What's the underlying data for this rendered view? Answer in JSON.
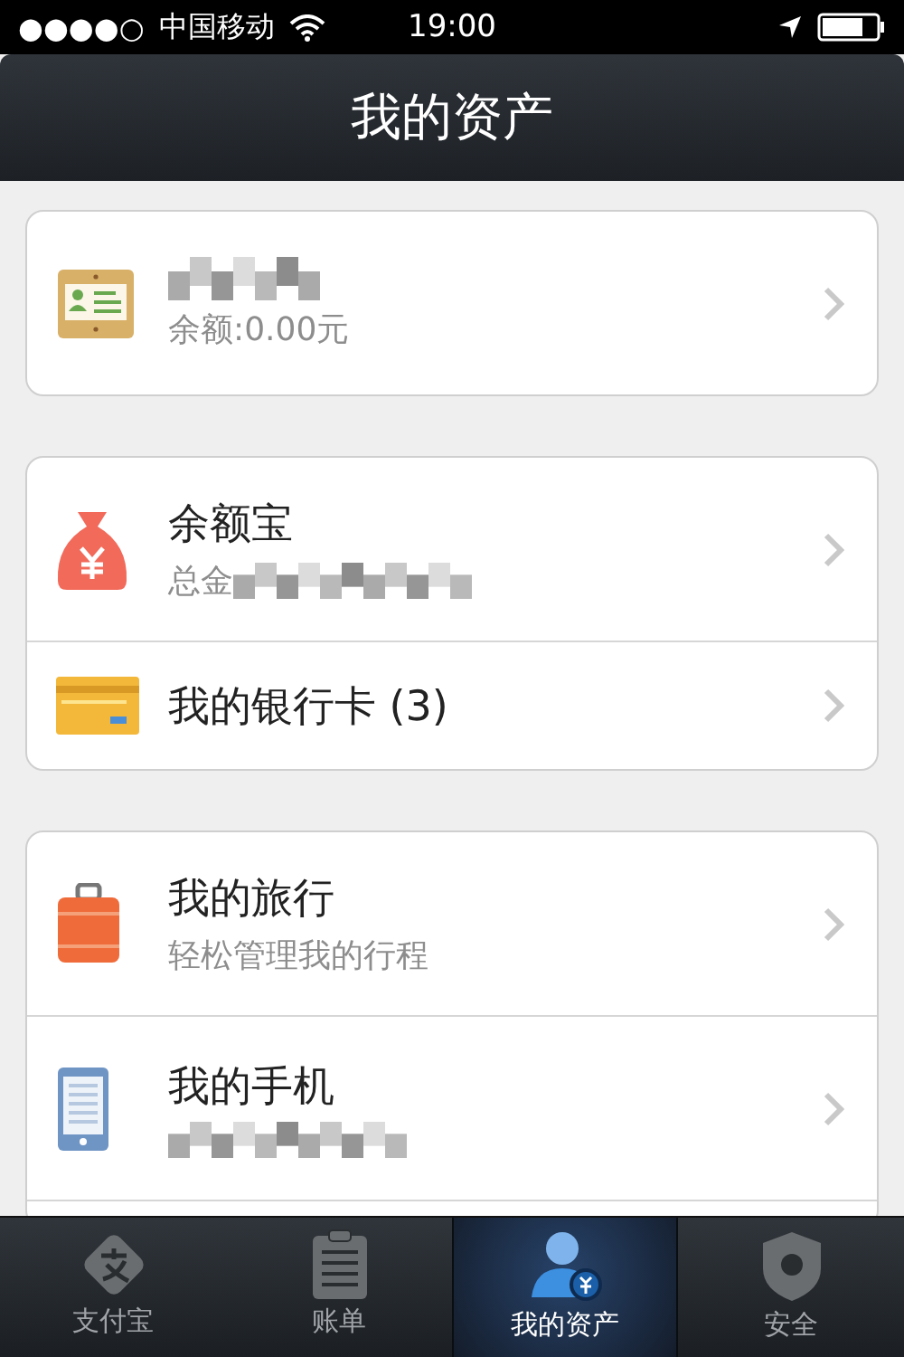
{
  "status_bar": {
    "signal_dots": "●●●●○",
    "carrier": "中国移动",
    "time": "19:00"
  },
  "header": {
    "title": "我的资产"
  },
  "groups": [
    {
      "continues": false,
      "rows": [
        {
          "kind": "id-card",
          "title_redacted": true,
          "subtitle": "余额:0.00元"
        }
      ]
    },
    {
      "continues": false,
      "rows": [
        {
          "kind": "money-bag",
          "title": "余额宝",
          "subtitle": "总金",
          "subtitle_redacted": true
        },
        {
          "kind": "bank-card",
          "title": "我的银行卡 (3)"
        }
      ]
    },
    {
      "continues": true,
      "rows": [
        {
          "kind": "suitcase",
          "title": "我的旅行",
          "subtitle": "轻松管理我的行程"
        },
        {
          "kind": "phone",
          "title": "我的手机",
          "subtitle_redacted": true
        }
      ]
    }
  ],
  "tabs": [
    {
      "kind": "pay",
      "label": "支付宝",
      "selected": false
    },
    {
      "kind": "bill",
      "label": "账单",
      "selected": false
    },
    {
      "kind": "assets",
      "label": "我的资产",
      "selected": true
    },
    {
      "kind": "shield",
      "label": "安全",
      "selected": false
    }
  ]
}
